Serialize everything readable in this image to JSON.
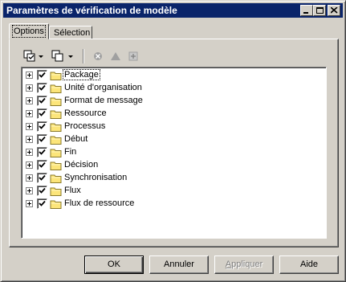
{
  "window": {
    "title": "Paramètres de vérification de modèle",
    "minimize_label": "_",
    "maximize_label": "□",
    "close_label": "×"
  },
  "tabs": [
    {
      "label": "Options",
      "active": true
    },
    {
      "label": "Sélection",
      "active": false
    }
  ],
  "toolbar": {
    "items": [
      "select-all-icon",
      "dropdown-arrow-icon",
      "deselect-icon",
      "dropdown-arrow-icon",
      "clear-icon",
      "warning-icon",
      "add-icon"
    ]
  },
  "tree": {
    "items": [
      {
        "label": "Package",
        "checked": true,
        "selected": true
      },
      {
        "label": "Unité d'organisation",
        "checked": true
      },
      {
        "label": "Format de message",
        "checked": true
      },
      {
        "label": "Ressource",
        "checked": true
      },
      {
        "label": "Processus",
        "checked": true
      },
      {
        "label": "Début",
        "checked": true
      },
      {
        "label": "Fin",
        "checked": true
      },
      {
        "label": "Décision",
        "checked": true
      },
      {
        "label": "Synchronisation",
        "checked": true
      },
      {
        "label": "Flux",
        "checked": true
      },
      {
        "label": "Flux de ressource",
        "checked": true
      }
    ]
  },
  "buttons": {
    "ok": "OK",
    "cancel": "Annuler",
    "apply_first": "A",
    "apply_rest": "ppliquer",
    "help": "Aide"
  },
  "colors": {
    "titlebar": "#0a246a",
    "face": "#d4d0c8",
    "folder": "#fce57a"
  }
}
